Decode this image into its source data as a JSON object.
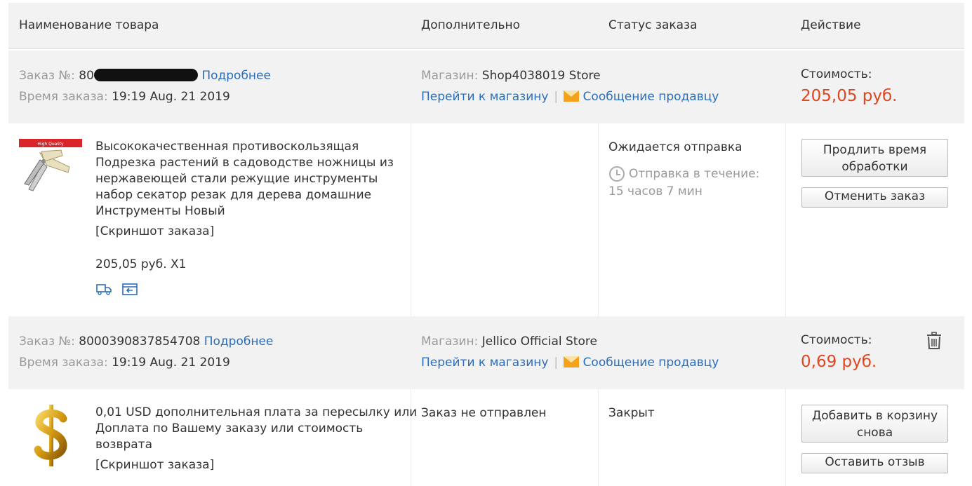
{
  "header": {
    "col_name": "Наименование товара",
    "col_extra": "Дополнительно",
    "col_status": "Статус заказа",
    "col_action": "Действие"
  },
  "orders": [
    {
      "order_label": "Заказ №:",
      "order_number": "80",
      "details_link": "Подробнее",
      "time_label": "Время заказа:",
      "time_value": "19:19 Aug. 21 2019",
      "store_label": "Магазин:",
      "store_name": "Shop4038019 Store",
      "go_to_store": "Перейти к магазину",
      "separator": "|",
      "message_seller": "Сообщение продавцу",
      "cost_label": "Стоимость:",
      "cost_value": "205,05 руб.",
      "item": {
        "image_badge": "High Quality",
        "title_lines": [
          "Высококачественная противоскользящая",
          "Подрезка растений в садоводстве ножницы из",
          "нержавеющей стали режущие инструменты",
          "набор секатор резак для дерева домашние",
          "Инструменты Новый"
        ],
        "screenshot_link": "[Скриншот заказа]",
        "price_qty": "205,05 руб. X1",
        "extra": "",
        "status": "Ожидается отправка",
        "countdown_line1": "Отправка в течение:",
        "countdown_line2": "15 часов 7 мин",
        "button1": "Продлить время обработки",
        "button2": "Отменить заказ"
      }
    },
    {
      "order_label": "Заказ №:",
      "order_number": "8000390837854708",
      "details_link": "Подробнее",
      "time_label": "Время заказа:",
      "time_value": "19:19 Aug. 21 2019",
      "store_label": "Магазин:",
      "store_name": "Jellico Official Store",
      "go_to_store": "Перейти к магазину",
      "separator": "|",
      "message_seller": "Сообщение продавцу",
      "cost_label": "Стоимость:",
      "cost_value": "0,69 руб.",
      "item": {
        "title_lines": [
          "0,01 USD дополнительная плата за пересылку или",
          "Доплата по Вашему заказу или стоимость",
          "возврата"
        ],
        "screenshot_link": "[Скриншот заказа]",
        "extra": "Заказ не отправлен",
        "status": "Закрыт",
        "button1": "Добавить в корзину снова",
        "button2": "Оставить отзыв"
      }
    }
  ],
  "colors": {
    "price": "#e0461f",
    "link": "#2a6ebb",
    "bar": "#f2f2f2"
  }
}
